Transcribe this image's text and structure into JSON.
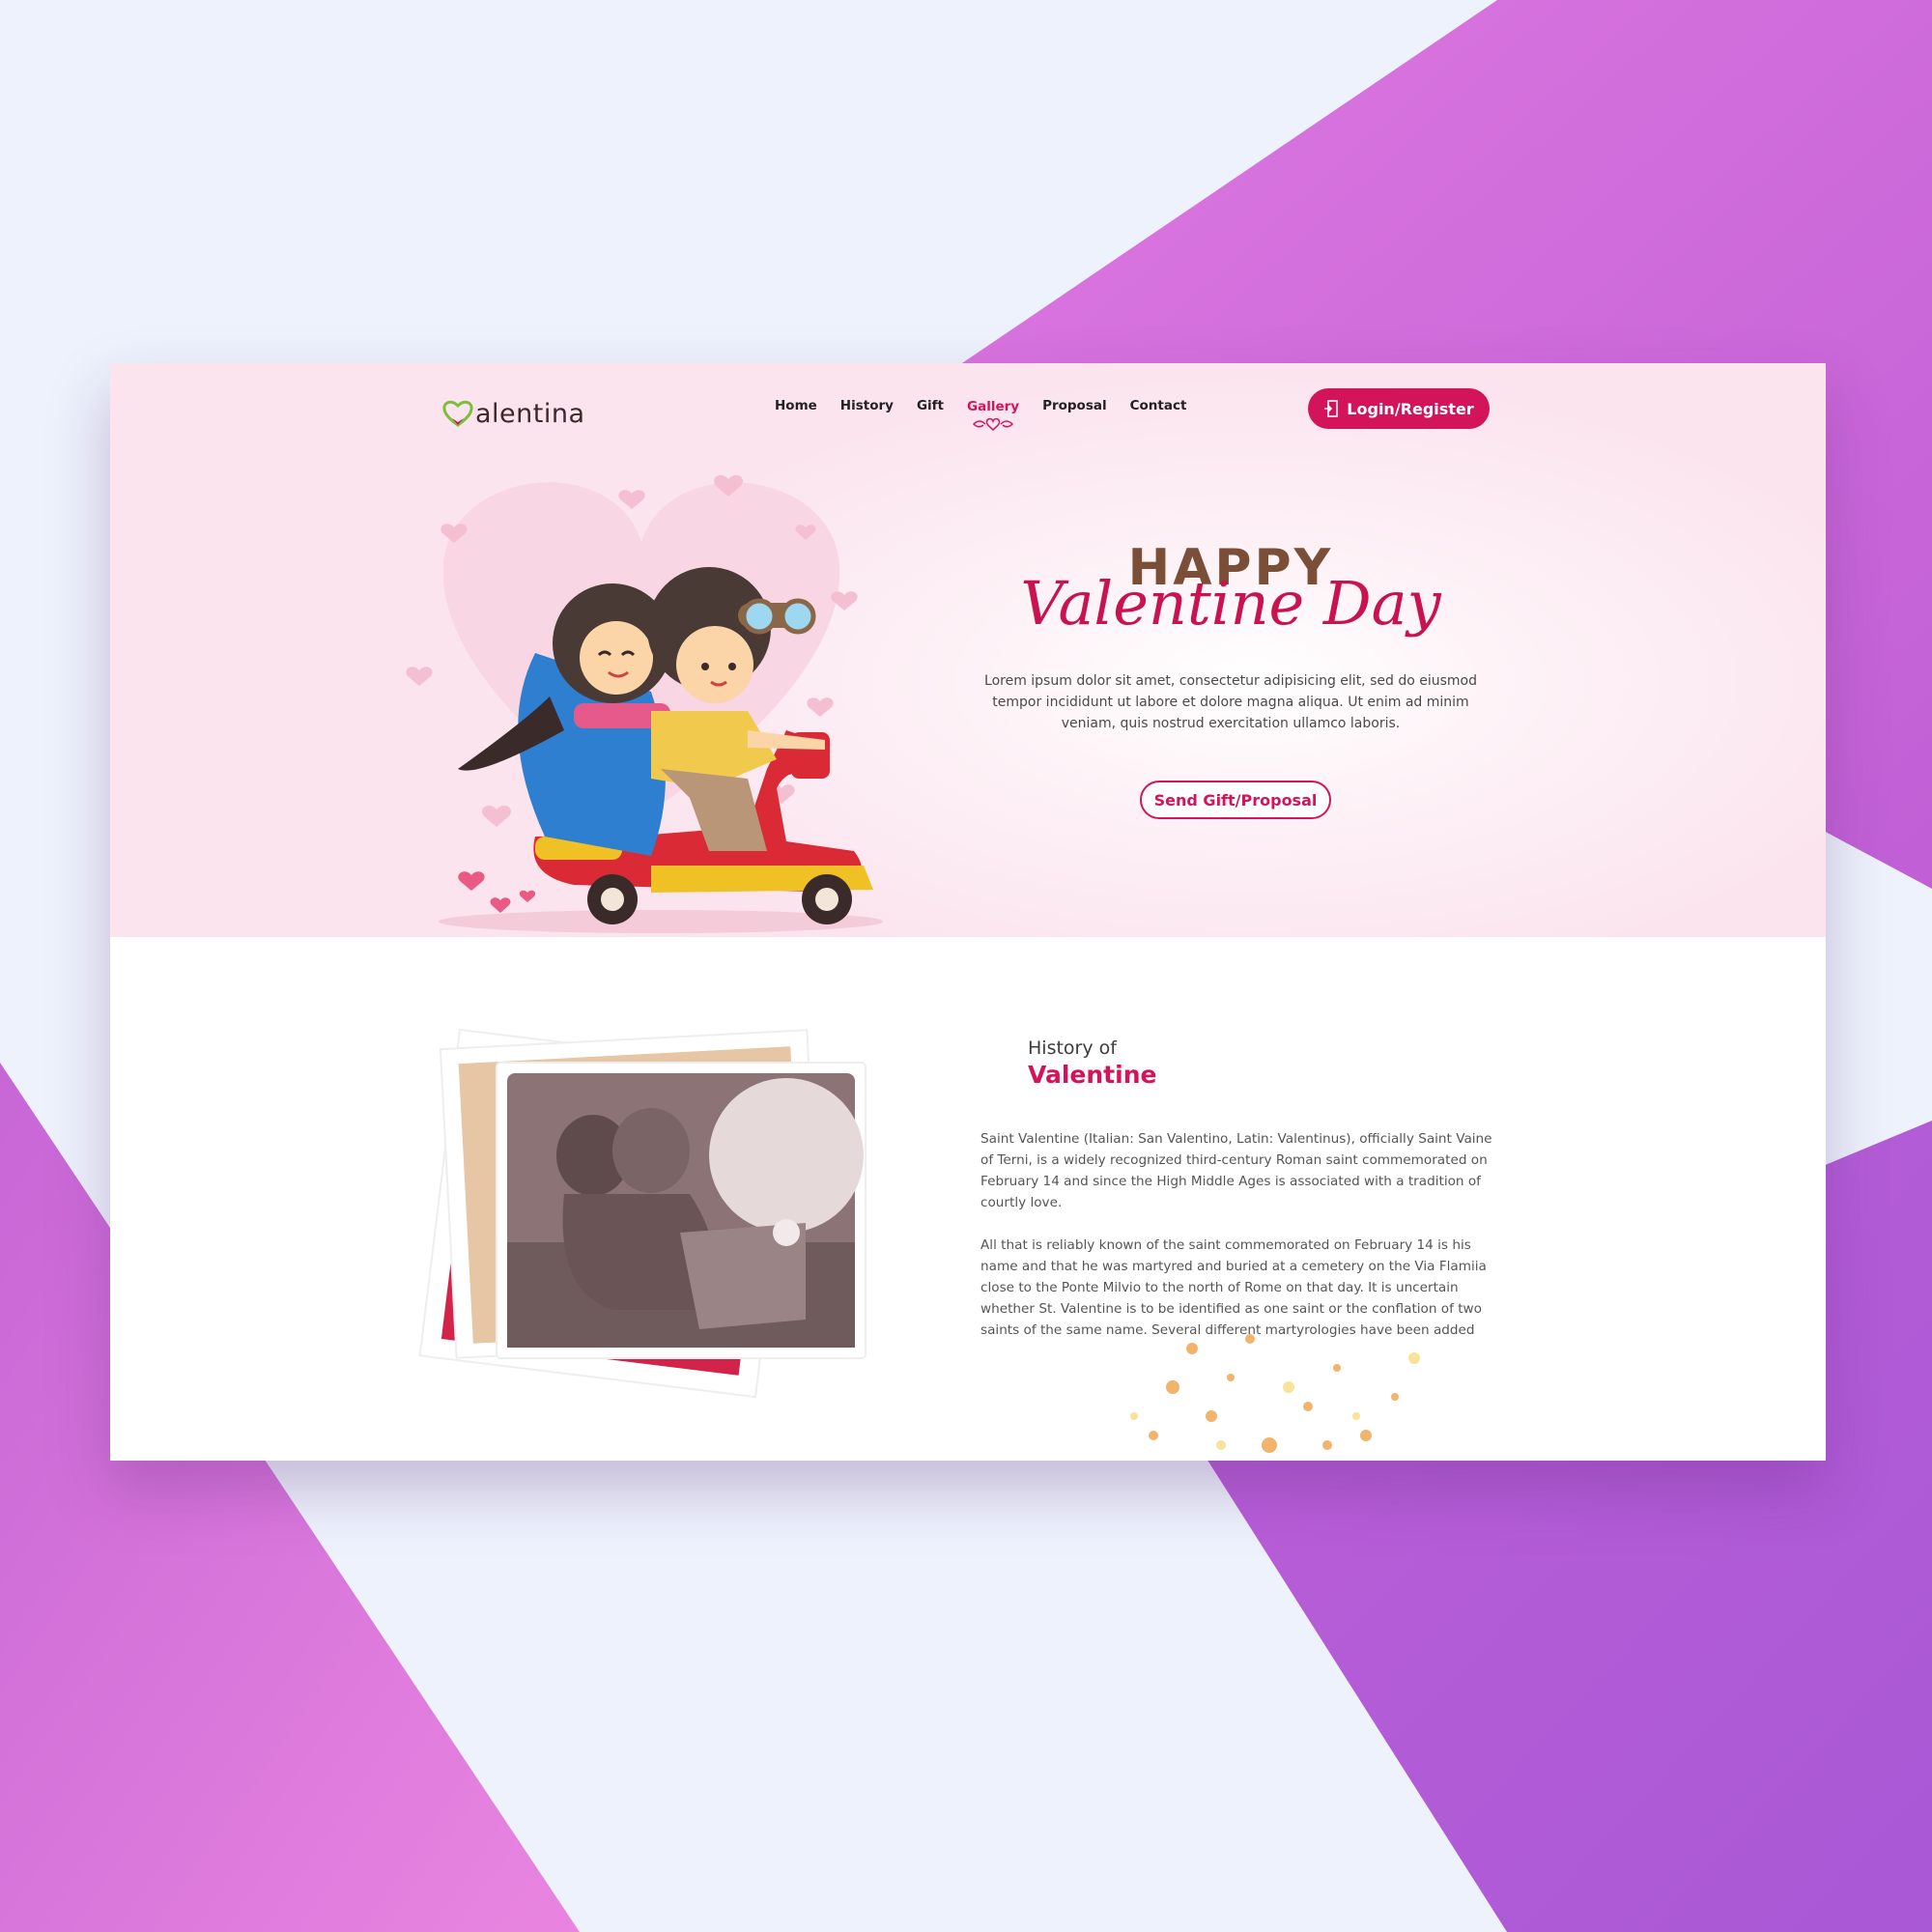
{
  "brand": {
    "logo_text": "alentina"
  },
  "nav": {
    "items": [
      {
        "label": "Home"
      },
      {
        "label": "History"
      },
      {
        "label": "Gift"
      },
      {
        "label": "Gallery"
      },
      {
        "label": "Proposal"
      },
      {
        "label": "Contact"
      }
    ],
    "active_item": "Gallery"
  },
  "header": {
    "login_label": "Login/Register"
  },
  "hero": {
    "title_top": "HAPPY",
    "title_script": "Valentine Day",
    "description": "Lorem ipsum dolor sit amet, consectetur adipisicing elit, sed do eiusmod tempor incididunt ut labore et dolore magna aliqua. Ut enim ad minim veniam, quis nostrud exercitation ullamco laboris.",
    "cta_label": "Send Gift/Proposal"
  },
  "history": {
    "heading_small": "History of",
    "heading_big": "Valentine",
    "paragraph_1": "Saint Valentine (Italian: San Valentino, Latin: Valentinus), officially Saint Vaine of Terni, is a widely recognized third-century Roman saint commemorated on February 14 and since the High Middle Ages is associated with a tradition of courtly love.",
    "paragraph_2": "All that is reliably known of the saint commemorated on February 14 is his name and that he was martyred and buried at a cemetery on the Via Flamiia close to the Ponte Milvio to the north of Rome on that day. It is uncertain whether St. Valentine is to be identified as one saint or the conflation of two saints of the same name. Several different martyrologies have been added"
  },
  "colors": {
    "accent": "#d4145a",
    "brown": "#7b4f37",
    "hero_bg": "#fbe4ee",
    "backdrop_purple": "#c561d9",
    "backdrop_light": "#edf2fc"
  },
  "icons": {
    "logo": "heart-icon",
    "login": "door-enter-icon",
    "nav_ornament": "heart-ornament-icon"
  }
}
